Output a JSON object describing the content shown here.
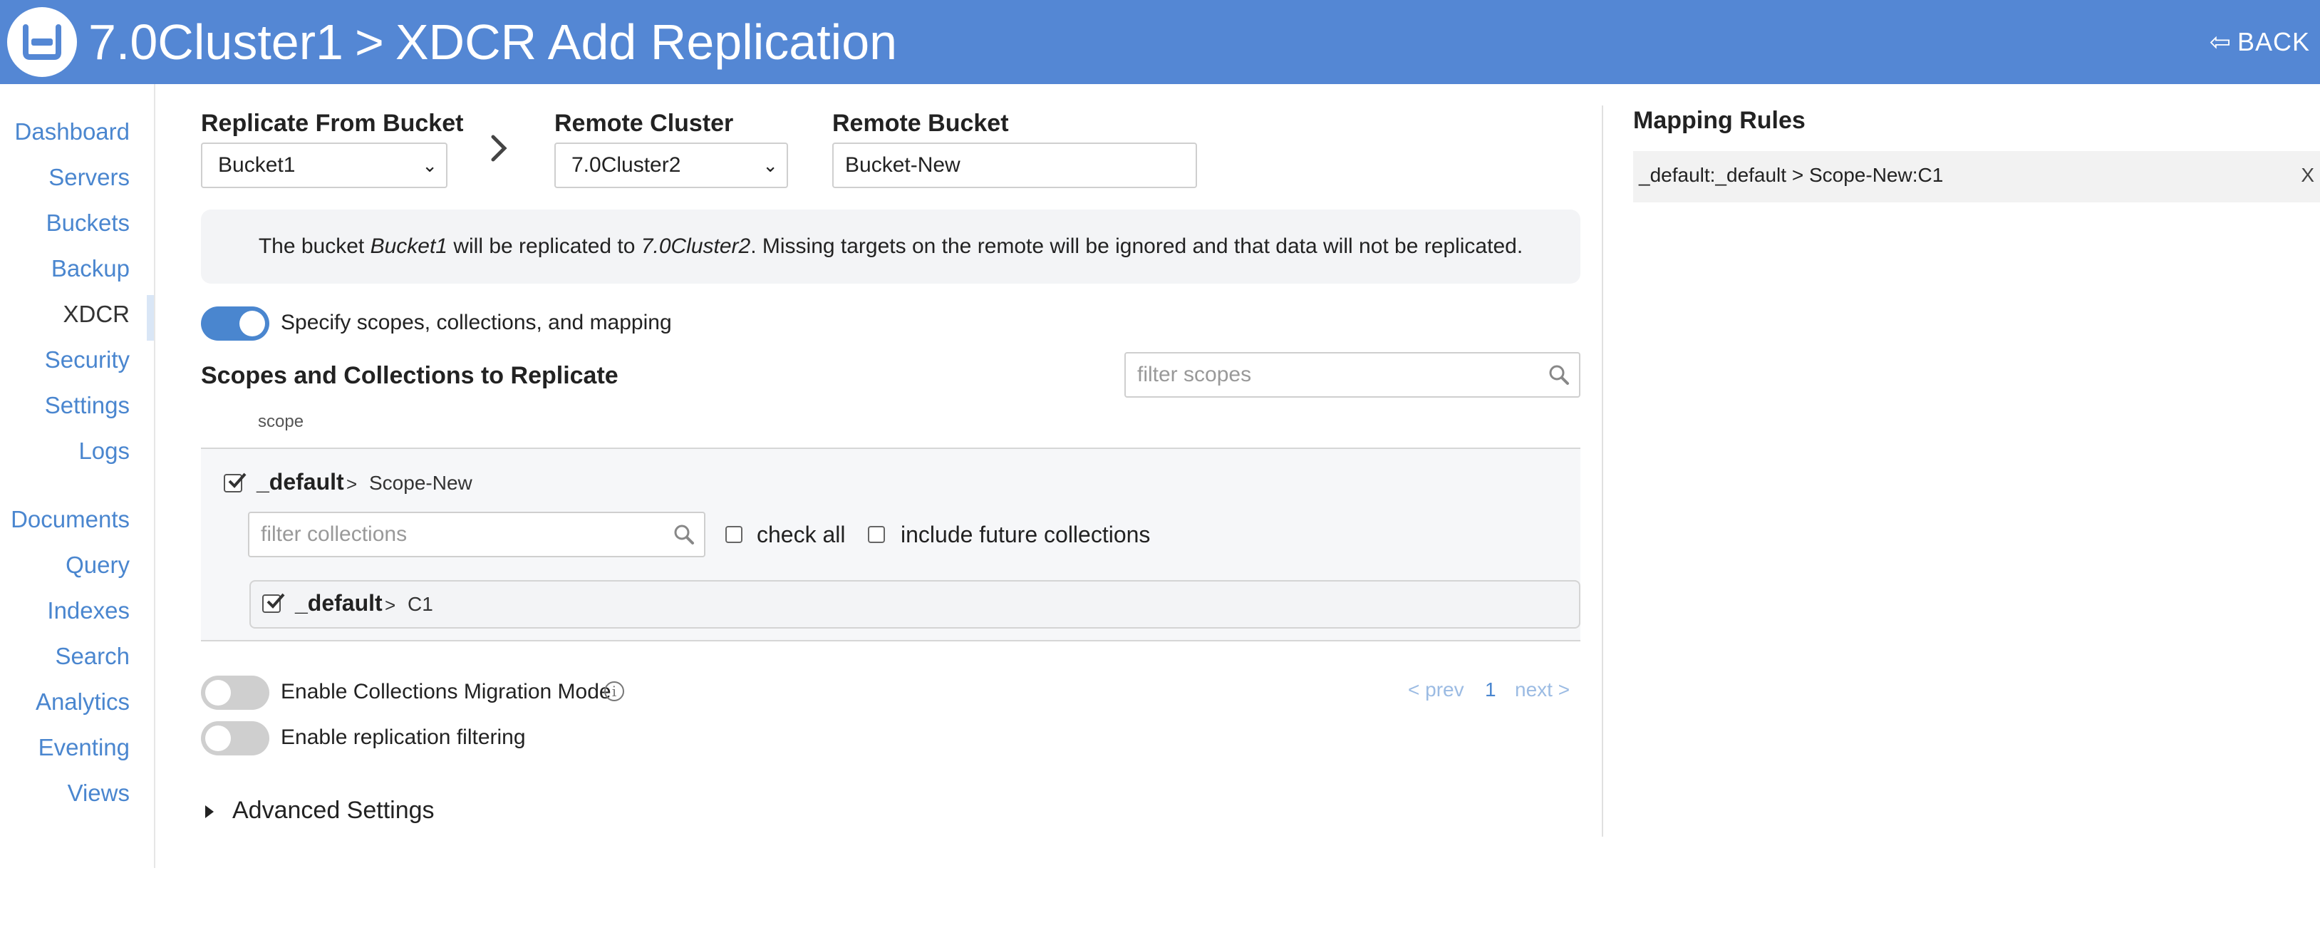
{
  "header": {
    "cluster": "7.0Cluster1",
    "separator": ">",
    "page_title": "XDCR Add Replication",
    "back_label": "BACK"
  },
  "sidebar": {
    "items": [
      {
        "label": "Dashboard"
      },
      {
        "label": "Servers"
      },
      {
        "label": "Buckets"
      },
      {
        "label": "Backup"
      },
      {
        "label": "XDCR",
        "active": true
      },
      {
        "label": "Security"
      },
      {
        "label": "Settings"
      },
      {
        "label": "Logs"
      },
      {
        "label": "Documents"
      },
      {
        "label": "Query"
      },
      {
        "label": "Indexes"
      },
      {
        "label": "Search"
      },
      {
        "label": "Analytics"
      },
      {
        "label": "Eventing"
      },
      {
        "label": "Views"
      }
    ]
  },
  "form": {
    "from_bucket_label": "Replicate From Bucket",
    "from_bucket_value": "Bucket1",
    "remote_cluster_label": "Remote Cluster",
    "remote_cluster_value": "7.0Cluster2",
    "remote_bucket_label": "Remote Bucket",
    "remote_bucket_value": "Bucket-New"
  },
  "info": {
    "prefix": "The bucket ",
    "bucket": "Bucket1",
    "middle": " will be replicated to ",
    "cluster": "7.0Cluster2",
    "suffix": ". Missing targets on the remote will be ignored and that data will not be replicated."
  },
  "toggles": {
    "specify_label": "Specify scopes, collections, and mapping",
    "specify_on": true,
    "migration_label": "Enable Collections Migration Mode",
    "migration_on": false,
    "filtering_label": "Enable replication filtering",
    "filtering_on": false
  },
  "scopes": {
    "title": "Scopes and Collections to Replicate",
    "filter_placeholder": "filter scopes",
    "column_header": "scope",
    "scope_name": "_default",
    "arrow": ">",
    "scope_target": "Scope-New",
    "collection_filter_placeholder": "filter collections",
    "check_all_label": "check all",
    "include_future_label": "include future collections",
    "collection_name": "_default",
    "collection_target": "C1"
  },
  "pager": {
    "prev": "< prev",
    "current": "1",
    "next": "next >"
  },
  "advanced_label": "Advanced Settings",
  "mapping": {
    "title": "Mapping Rules",
    "rule": "_default:_default > Scope-New:C1",
    "remove": "X"
  },
  "colors": {
    "header": "#5487d4",
    "link": "#4a86cf",
    "toggle_on": "#4a86cf",
    "toggle_off": "#cfcfcf"
  }
}
